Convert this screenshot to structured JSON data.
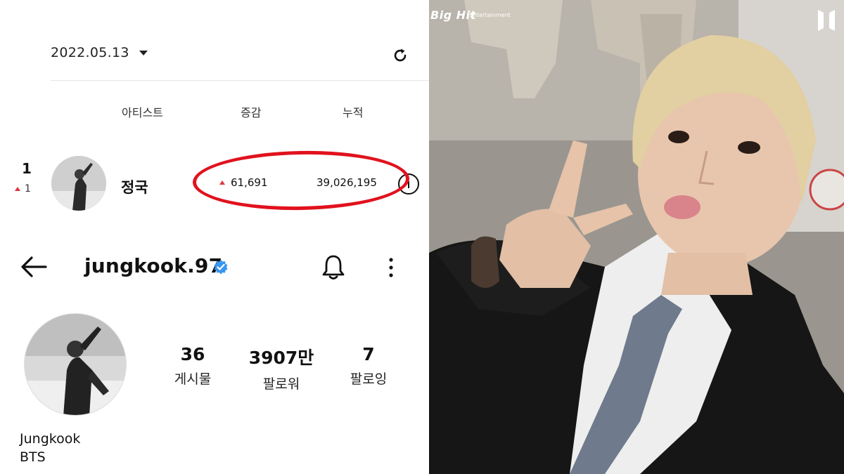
{
  "chart": {
    "date": "2022.05.13",
    "columns": {
      "artist": "아티스트",
      "change": "증감",
      "total": "누적"
    },
    "row": {
      "rank": "1",
      "rank_change": "1",
      "artist": "정국",
      "increase": "61,691",
      "cumulative": "39,026,195"
    }
  },
  "profile": {
    "username": "jungkook.97",
    "stats": [
      {
        "value": "36",
        "label": "게시물"
      },
      {
        "value": "3907만",
        "label": "팔로워"
      },
      {
        "value": "7",
        "label": "팔로잉"
      }
    ],
    "display_name": "Jungkook",
    "bio": "BTS"
  },
  "photo": {
    "watermark": "Big Hit",
    "watermark_sub": "Entertainment"
  },
  "colors": {
    "highlight_red": "#e1121d",
    "verified_blue": "#3897f0",
    "up_red": "#e0343f"
  }
}
